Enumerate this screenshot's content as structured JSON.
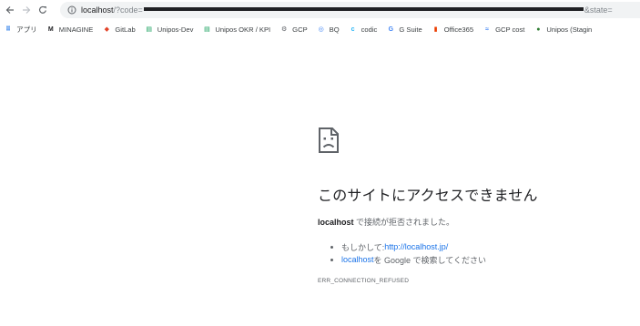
{
  "omnibox": {
    "host": "localhost",
    "path": "/?code=",
    "tail": "&state="
  },
  "bookmarks": [
    {
      "label": "アプリ",
      "icon": "apps-grid-icon",
      "color": "#1a73e8"
    },
    {
      "label": "MINAGINE",
      "icon": "minagine-m-icon",
      "color": "#202124"
    },
    {
      "label": "GitLab",
      "icon": "gitlab-icon",
      "color": "#e24329"
    },
    {
      "label": "Unipos-Dev",
      "icon": "sheets-icon",
      "color": "#0f9d58"
    },
    {
      "label": "Unipos OKR / KPI",
      "icon": "sheets-icon",
      "color": "#0f9d58"
    },
    {
      "label": "GCP",
      "icon": "gcp-gear-icon",
      "color": "#5f6368"
    },
    {
      "label": "BQ",
      "icon": "bigquery-icon",
      "color": "#4285f4"
    },
    {
      "label": "codic",
      "icon": "codic-icon",
      "color": "#29b6f6"
    },
    {
      "label": "G Suite",
      "icon": "google-g-icon",
      "color": "#4285f4"
    },
    {
      "label": "Office365",
      "icon": "office-icon",
      "color": "#eb3c00"
    },
    {
      "label": "GCP cost",
      "icon": "gcp-cost-icon",
      "color": "#4285f4"
    },
    {
      "label": "Unipos (Stagin",
      "icon": "unipos-icon",
      "color": "#2e7d32"
    }
  ],
  "error": {
    "title": "このサイトにアクセスできません",
    "host": "localhost",
    "desc_suffix": " で接続が拒否されました。",
    "suggest1_prefix": "もしかして: ",
    "suggest1_link": "http://localhost.jp/",
    "suggest2_link": "localhost",
    "suggest2_suffix": " を Google で検索してください",
    "code": "ERR_CONNECTION_REFUSED"
  }
}
